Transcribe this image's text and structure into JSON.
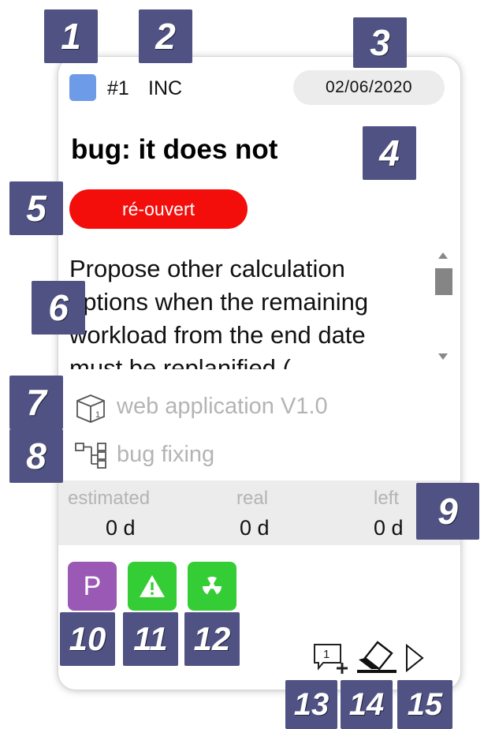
{
  "card": {
    "ref": "#1",
    "type": "INC",
    "date": "02/06/2020",
    "title": "bug: it does not",
    "status": "ré-ouvert",
    "description": "Propose other calculation options when the remaining workload from the end date must be replanified (",
    "product": "web application V1.0",
    "activity": "bug fixing",
    "workload": [
      {
        "label": "estimated",
        "value": "0 d"
      },
      {
        "label": "real",
        "value": "0 d"
      },
      {
        "label": "left",
        "value": "0 d"
      }
    ],
    "tags": [
      {
        "label": "P",
        "icon": "priority-icon",
        "color": "#9b59b6"
      },
      {
        "label": "",
        "icon": "warning-icon",
        "color": "#35cd35"
      },
      {
        "label": "",
        "icon": "radiation-icon",
        "color": "#35cd35"
      }
    ],
    "colors": {
      "type_square": "#6d9be8",
      "status": "#f30e0b"
    }
  },
  "markers": [
    "1",
    "2",
    "3",
    "4",
    "5",
    "6",
    "7",
    "8",
    "9",
    "10",
    "11",
    "12",
    "13",
    "14",
    "15"
  ]
}
